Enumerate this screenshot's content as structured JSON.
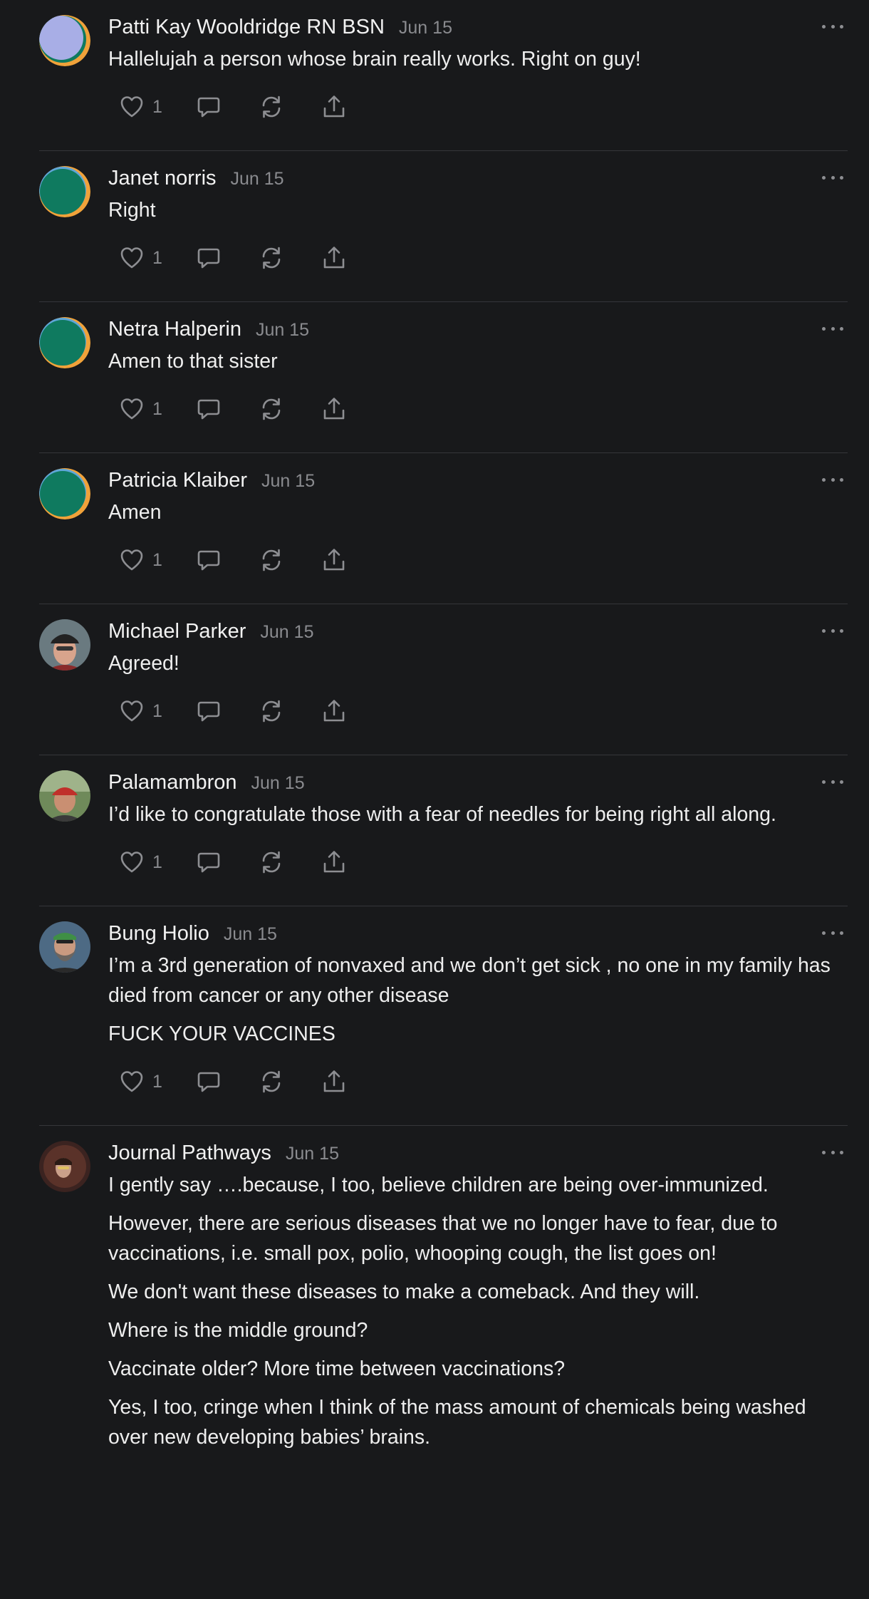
{
  "colors": {
    "background": "#18191b",
    "divider": "#35363a",
    "text": "#eeeeee",
    "muted": "#8a8b8f"
  },
  "icons": {
    "like": "heart-icon",
    "reply": "speech-bubble-icon",
    "restack": "restack-arrows-icon",
    "share": "share-upload-icon",
    "more": "ellipsis-icon"
  },
  "comments": [
    {
      "author": "Patti Kay Wooldridge RN BSN",
      "date": "Jun 15",
      "avatar": "lavender-default",
      "paragraphs": [
        "Hallelujah a person whose brain really works. Right on guy!"
      ],
      "likes": "1"
    },
    {
      "author": "Janet norris",
      "date": "Jun 15",
      "avatar": "green-default",
      "paragraphs": [
        "Right"
      ],
      "likes": "1"
    },
    {
      "author": "Netra Halperin",
      "date": "Jun 15",
      "avatar": "green-default",
      "paragraphs": [
        "Amen to that sister"
      ],
      "likes": "1"
    },
    {
      "author": "Patricia Klaiber",
      "date": "Jun 15",
      "avatar": "green-default",
      "paragraphs": [
        "Amen"
      ],
      "likes": "1"
    },
    {
      "author": "Michael Parker",
      "date": "Jun 15",
      "avatar": "photo-cap",
      "paragraphs": [
        "Agreed!"
      ],
      "likes": "1"
    },
    {
      "author": "Palamambron",
      "date": "Jun 15",
      "avatar": "photo-redcap",
      "paragraphs": [
        "I’d like to congratulate those with a fear of needles for being right all along."
      ],
      "likes": "1"
    },
    {
      "author": "Bung Holio",
      "date": "Jun 15",
      "avatar": "photo-beard",
      "paragraphs": [
        "I’m a 3rd generation of nonvaxed and we don’t get sick , no one in my family has died from cancer or any other disease",
        "FUCK YOUR VACCINES"
      ],
      "likes": "1"
    },
    {
      "author": "Journal Pathways",
      "date": "Jun 15",
      "avatar": "photo-dark",
      "paragraphs": [
        "I gently say ….because, I too, believe children are being over-immunized.",
        "However, there are serious diseases that we no longer have to fear, due to vaccinations, i.e. small pox, polio, whooping cough, the list goes on!",
        "We don't want these diseases to make a comeback. And they will.",
        "Where is the middle ground?",
        "Vaccinate older? More time between vaccinations?",
        "Yes, I too, cringe when I think of the mass amount of chemicals being washed over new developing babies’ brains."
      ],
      "likes": ""
    }
  ]
}
